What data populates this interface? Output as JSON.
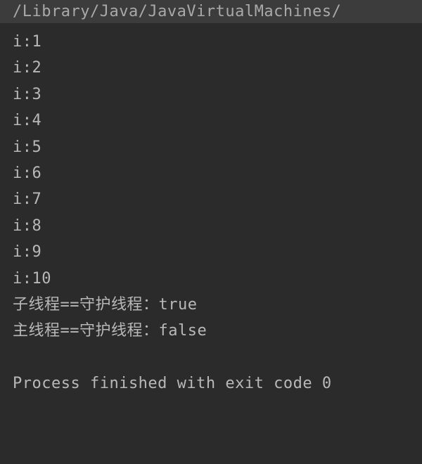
{
  "header": {
    "path": "/Library/Java/JavaVirtualMachines/"
  },
  "output": {
    "lines": [
      "i:1",
      "i:2",
      "i:3",
      "i:4",
      "i:5",
      "i:6",
      "i:7",
      "i:8",
      "i:9",
      "i:10",
      "子线程==守护线程：true",
      "主线程==守护线程：false",
      "",
      "Process finished with exit code 0"
    ]
  }
}
